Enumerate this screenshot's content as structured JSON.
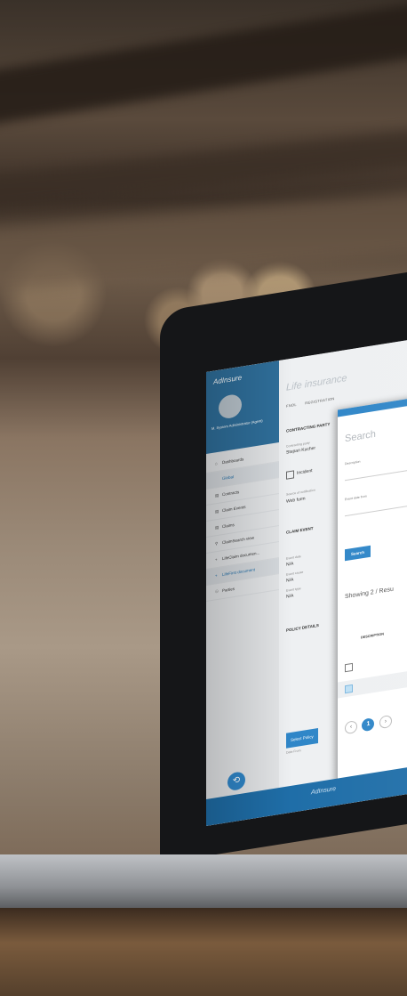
{
  "app": {
    "logo": "AdInsure",
    "footer_brand": "AdInsure",
    "accent": "#2f86c8"
  },
  "sidebar": {
    "user": "M. System Administrator (Agent)",
    "items": [
      {
        "label": "Dashboards",
        "icon": "home-icon"
      },
      {
        "label": "Global",
        "icon": ""
      },
      {
        "label": "Contracts",
        "icon": "document-icon"
      },
      {
        "label": "Claim Events",
        "icon": "document-icon"
      },
      {
        "label": "Claims",
        "icon": "document-icon"
      },
      {
        "label": "ClaimSearch view",
        "icon": "search-icon"
      },
      {
        "label": "LifeClaim documen...",
        "icon": "plus-icon"
      },
      {
        "label": "LifeFirst document",
        "icon": "plus-icon"
      },
      {
        "label": "Parties",
        "icon": "people-icon"
      }
    ],
    "fab_icon": "history-icon"
  },
  "main": {
    "title": "Life insurance",
    "tabs": [
      "FNOL",
      "REGISTRATION"
    ],
    "contracting_party_heading": "CONTRACTING PARTY",
    "contracting_party_label": "Contracting party",
    "contracting_party_value": "Stepan Kucher",
    "incident_label": "Incident",
    "source_label": "Source of notification",
    "source_value": "Web form",
    "claim_event_heading": "CLAIM EVENT",
    "event_date_label": "Event date",
    "event_date_value": "N/A",
    "event_cause_label": "Event cause",
    "event_cause_value": "N/A",
    "event_type_label": "Event type",
    "event_type_value": "N/A",
    "policy_details_heading": "POLICY DETAILS",
    "select_policy_button": "Select Policy",
    "date_from_label": "Date From"
  },
  "modal": {
    "title": "Search",
    "description_label": "Description",
    "event_date_from_label": "Event date from",
    "search_button": "Search",
    "showing_text": "Showing 2 / Resu",
    "column_description": "DESCRIPTION",
    "rows": [
      {
        "selected": false
      },
      {
        "selected": true
      }
    ],
    "page_prev": "‹",
    "page_current": "1",
    "page_next": "›"
  }
}
